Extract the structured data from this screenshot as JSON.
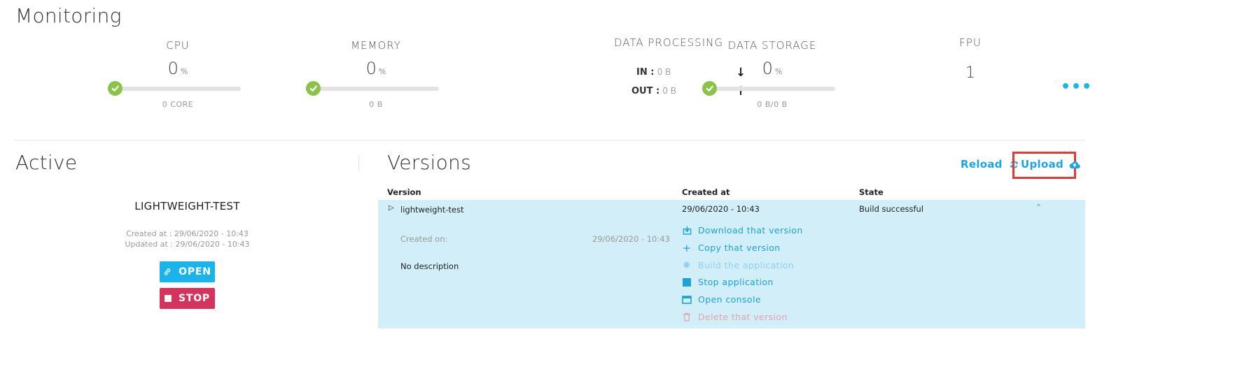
{
  "monitoring": {
    "title": "Monitoring",
    "cpu": {
      "label": "CPU",
      "value": "0",
      "unit": "%",
      "sub": "0 CORE",
      "level": 0
    },
    "memory": {
      "label": "MEMORY",
      "value": "0",
      "unit": "%",
      "sub": "0 B",
      "level": 0
    },
    "data_processing": {
      "label": "DATA PROCESSING",
      "in_label": "IN :",
      "in_value": "0 B",
      "out_label": "OUT :",
      "out_value": "0 B"
    },
    "data_storage": {
      "label": "DATA STORAGE",
      "value": "0",
      "unit": "%",
      "sub": "0 B/0 B",
      "level": 0
    },
    "fpu": {
      "label": "FPU",
      "value": "1"
    },
    "more_label": "•••"
  },
  "active": {
    "title": "Active",
    "app_name": "LIGHTWEIGHT-TEST",
    "created": "Created at : 29/06/2020 - 10:43",
    "updated": "Updated at : 29/06/2020 - 10:43",
    "open_label": "OPEN",
    "stop_label": "STOP"
  },
  "versions": {
    "title": "Versions",
    "reload_label": "Reload",
    "upload_label": "Upload",
    "columns": {
      "version": "Version",
      "created_at": "Created at",
      "state": "State"
    },
    "row": {
      "name": "lightweight-test",
      "created_at": "29/06/2020 - 10:43",
      "state": "Build successful",
      "created_on_label": "Created on:",
      "created_on_value": "29/06/2020 - 10:43",
      "description": "No description"
    },
    "actions": {
      "download": "Download that version",
      "copy": "Copy that version",
      "build": "Build the application",
      "stop": "Stop application",
      "console": "Open console",
      "delete": "Delete that version"
    }
  },
  "colors": {
    "accent": "#19b4ea",
    "ok": "#8bc34a",
    "danger": "#d3335c",
    "row": "#d2eef8",
    "highlight": "#e53935"
  }
}
